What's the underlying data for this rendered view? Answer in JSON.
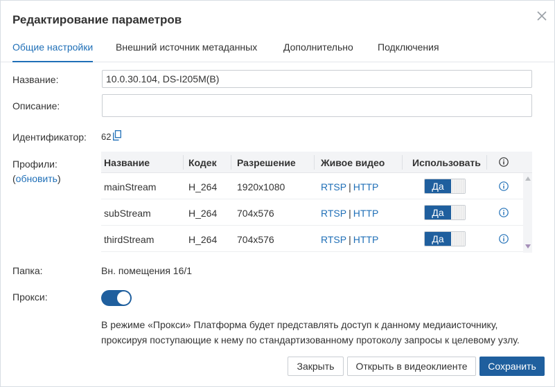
{
  "dialog": {
    "title": "Редактирование параметров",
    "close_icon": "close-icon"
  },
  "tabs": [
    {
      "label": "Общие настройки",
      "active": true
    },
    {
      "label": "Внешний источник метаданных",
      "active": false
    },
    {
      "label": "Дополнительно",
      "active": false
    },
    {
      "label": "Подключения",
      "active": false
    }
  ],
  "form": {
    "name_label": "Название:",
    "name_value": "10.0.30.104, DS-I205M(B)",
    "description_label": "Описание:",
    "description_value": "",
    "identifier_label": "Идентификатор:",
    "identifier_value": "62",
    "profiles_label": "Профили:",
    "profiles_refresh_open": "(",
    "profiles_refresh_link": "обновить",
    "profiles_refresh_close": ")",
    "folder_label": "Папка:",
    "folder_value": "Вн. помещения 16/1",
    "proxy_label": "Прокси:",
    "proxy_enabled": true,
    "proxy_description": "В режиме «Прокси» Платформа будет представлять доступ к данному медиаисточнику, проксируя поступающие к нему по стандартизованному протоколу запросы к целевому узлу."
  },
  "profiles_table": {
    "headers": {
      "name": "Название",
      "codec": "Кодек",
      "resolution": "Разрешение",
      "live": "Живое видео",
      "use": "Использовать"
    },
    "rows": [
      {
        "name": "mainStream",
        "codec": "H_264",
        "resolution": "1920x1080",
        "rtsp": "RTSP",
        "sep": "|",
        "http": "HTTP",
        "use": "Да"
      },
      {
        "name": "subStream",
        "codec": "H_264",
        "resolution": "704x576",
        "rtsp": "RTSP",
        "sep": "|",
        "http": "HTTP",
        "use": "Да"
      },
      {
        "name": "thirdStream",
        "codec": "H_264",
        "resolution": "704x576",
        "rtsp": "RTSP",
        "sep": "|",
        "http": "HTTP",
        "use": "Да"
      }
    ]
  },
  "buttons": {
    "close": "Закрыть",
    "open_client": "Открыть в видеоклиенте",
    "save": "Сохранить"
  },
  "colors": {
    "accent": "#1f6fb7",
    "primary_button": "#1f5f9e"
  }
}
